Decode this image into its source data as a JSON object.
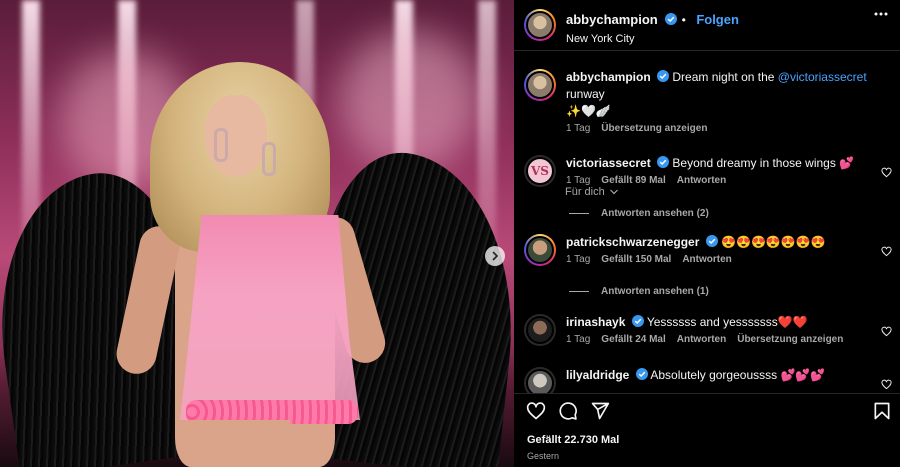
{
  "post": {
    "author": "abbychampion",
    "follow_label": "Folgen",
    "location": "New York City"
  },
  "caption": {
    "user": "abbychampion",
    "text_before": "Dream night on the ",
    "mention": "@victoriassecret",
    "text_after": " runway",
    "emoji_line": "✨🤍🪽",
    "time": "1 Tag",
    "translate_label": "Übersetzung anzeigen"
  },
  "filter_label": "Für dich",
  "comments": [
    {
      "user": "victoriassecret",
      "text": "Beyond dreamy in those wings 💕",
      "time": "1 Tag",
      "likes": "Gefällt 89 Mal",
      "reply_label": "Antworten",
      "view_replies": "Antworten ansehen (2)"
    },
    {
      "user": "patrickschwarzenegger",
      "text": "😍😍😍😍😍😍😍",
      "time": "1 Tag",
      "likes": "Gefällt 150 Mal",
      "reply_label": "Antworten",
      "view_replies": "Antworten ansehen (1)"
    },
    {
      "user": "irinashayk",
      "text": "Yessssss and yesssssss❤️❤️",
      "time": "1 Tag",
      "likes": "Gefällt 24 Mal",
      "reply_label": "Antworten",
      "translate_label": "Übersetzung anzeigen"
    },
    {
      "user": "lilyaldridge",
      "text": "Absolutely gorgeoussss 💕💕💕"
    }
  ],
  "footer": {
    "likes_text": "Gefällt 22.730 Mal",
    "date_text": "Gestern"
  },
  "icons": {
    "more": "more-horizontal-icon",
    "like": "heart-icon",
    "comment": "comment-bubble-icon",
    "share": "paper-plane-icon",
    "save": "bookmark-icon",
    "next": "chevron-right-icon",
    "verified": "verified-badge-icon"
  },
  "colors": {
    "background": "#000000",
    "link": "#4aa3ff",
    "verified": "#3897f0",
    "secondary_text": "#a8a8a8"
  }
}
